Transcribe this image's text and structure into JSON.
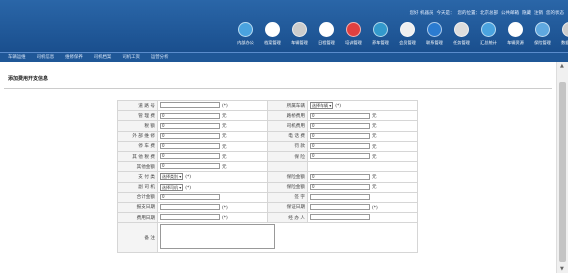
{
  "header": {
    "links": [
      "您好 机器员",
      "今天是：",
      "您的位置：北京总部",
      "公共邮箱",
      "隐藏",
      "注销",
      "您的状态"
    ],
    "modules": [
      "内部办公",
      "档案管理",
      "车辆管理",
      "日程管理",
      "培训管理",
      "养车管理",
      "会员管理",
      "联系管理",
      "任务管理",
      "汇总统计",
      "车辆资源",
      "保险管理",
      "数据设置"
    ]
  },
  "nav": [
    "车辆运维",
    "司机信息",
    "维修保养",
    "司机档案",
    "司机工资",
    "运营分析"
  ],
  "page_title": "添加费用开支信息",
  "rows": [
    {
      "l1": "道 路 号",
      "t1": "in",
      "v1": "",
      "u1": "(*)",
      "l2": "所属车辆",
      "t2": "sel",
      "v2": "选择车辆",
      "u2": "(*)"
    },
    {
      "l1": "管 理 费",
      "t1": "in",
      "v1": "0",
      "u1": "元",
      "l2": "路桥费用",
      "t2": "in",
      "v2": "0",
      "u2": "元"
    },
    {
      "l1": "税 额",
      "t1": "in",
      "v1": "0",
      "u1": "元",
      "l2": "司机费用",
      "t2": "in",
      "v2": "0",
      "u2": "元"
    },
    {
      "l1": "外 部 维 修",
      "t1": "in",
      "v1": "0",
      "u1": "元",
      "l2": "电 话 费",
      "t2": "in",
      "v2": "0",
      "u2": "元"
    },
    {
      "l1": "停 车 费",
      "t1": "in",
      "v1": "0",
      "u1": "元",
      "l2": "罚 款",
      "t2": "in",
      "v2": "0",
      "u2": "元"
    },
    {
      "l1": "其 他 税 费",
      "t1": "in",
      "v1": "0",
      "u1": "元",
      "l2": "保 险",
      "t2": "in",
      "v2": "0",
      "u2": "元"
    },
    {
      "l1": "其他金额",
      "t1": "in",
      "v1": "0",
      "u1": "元",
      "l2": "",
      "t2": "",
      "v2": "",
      "u2": ""
    },
    {
      "l1": "支 付 类",
      "t1": "sel",
      "v1": "选择类别",
      "u1": "(*)",
      "l2": "保险金额",
      "t2": "in",
      "v2": "0",
      "u2": "元"
    },
    {
      "l1": "副 司 机",
      "t1": "sel",
      "v1": "选择司机",
      "u1": "(*)",
      "l2": "保险金额",
      "t2": "in",
      "v2": "0",
      "u2": "元"
    },
    {
      "l1": "合计金额",
      "t1": "in",
      "v1": "0",
      "u1": "",
      "l2": "签 字",
      "t2": "in",
      "v2": "",
      "u2": ""
    },
    {
      "l1": "报支日期",
      "t1": "in",
      "v1": "",
      "u1": "(*)",
      "l2": "保证日期",
      "t2": "in",
      "v2": "",
      "u2": "(*)"
    },
    {
      "l1": "费用日期",
      "t1": "in",
      "v1": "",
      "u1": "(*)",
      "l2": "经 办 人",
      "t2": "in",
      "v2": "",
      "u2": ""
    }
  ],
  "remark_label": "备 注",
  "colors": {
    "header": "#1a4f8e",
    "nav": "#1f5797"
  }
}
